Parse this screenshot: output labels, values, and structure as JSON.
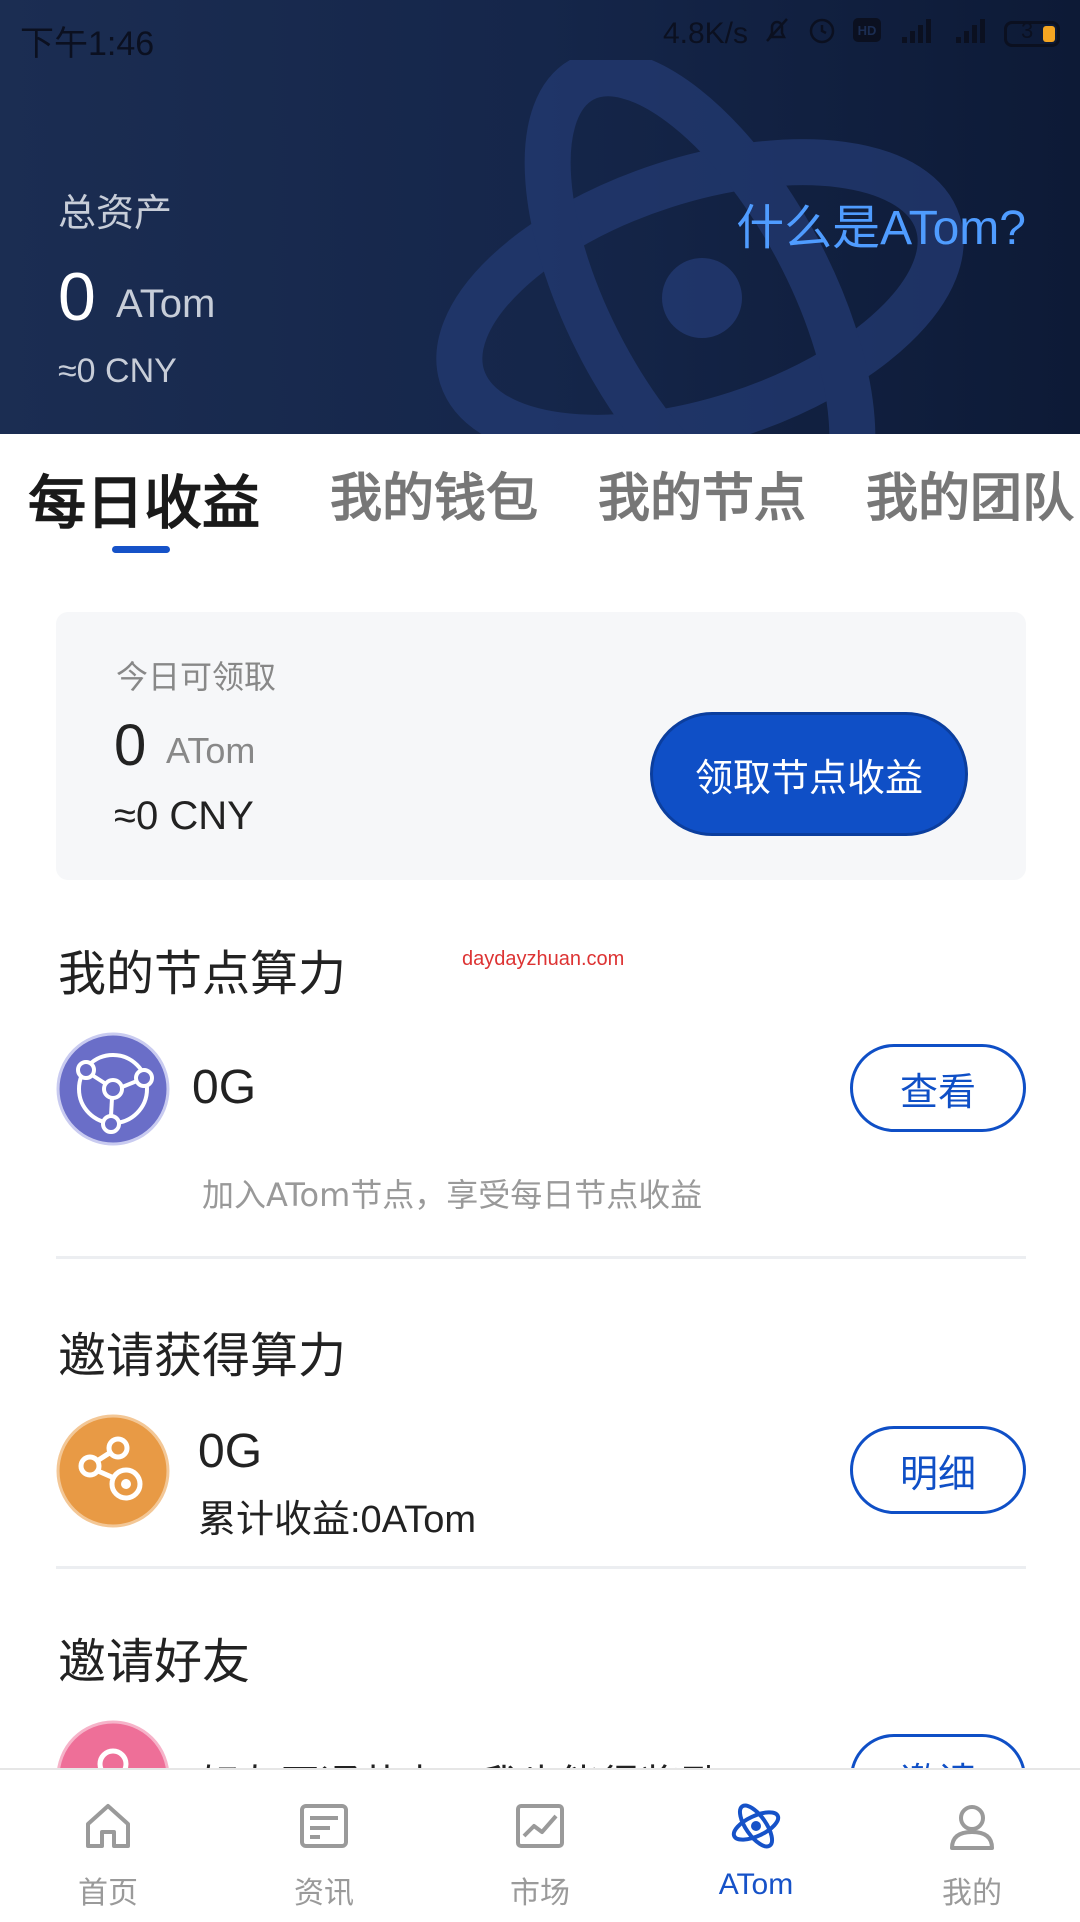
{
  "status": {
    "time": "下午1:46",
    "speed": "4.8K/s",
    "battery": "3"
  },
  "header": {
    "total_label": "总资产",
    "total_value": "0",
    "total_unit": "ATom",
    "total_cny": "≈0 CNY",
    "what_link": "什么是ATom?"
  },
  "tabs": [
    {
      "label": "每日收益",
      "active": true
    },
    {
      "label": "我的钱包"
    },
    {
      "label": "我的节点"
    },
    {
      "label": "我的团队"
    }
  ],
  "claim": {
    "label": "今日可领取",
    "value": "0",
    "unit": "ATom",
    "cny": "≈0 CNY",
    "button": "领取节点收益"
  },
  "node_power": {
    "title": "我的节点算力",
    "watermark": "daydayzhuan.com",
    "value": "0G",
    "button": "查看",
    "hint": "加入ATom节点，享受每日节点收益"
  },
  "invite_power": {
    "title": "邀请获得算力",
    "value": "0G",
    "accum": "累计收益:0ATom",
    "button": "明细"
  },
  "invite_friends": {
    "title": "邀请好友",
    "partial_text": "好友开通节点，我也能得奖励",
    "button": "邀请"
  },
  "nav": [
    {
      "label": "首页",
      "icon": "home-icon"
    },
    {
      "label": "资讯",
      "icon": "news-icon"
    },
    {
      "label": "市场",
      "icon": "market-chart-icon"
    },
    {
      "label": "ATom",
      "icon": "atom-icon",
      "active": true
    },
    {
      "label": "我的",
      "icon": "profile-icon"
    }
  ],
  "colors": {
    "accent": "#0f4fc6",
    "header_bg": "#15264a",
    "link": "#4f9cff",
    "node_purple": "#6a6ec8",
    "invite_orange": "#e89a45",
    "friend_pink": "#ee6f98"
  }
}
